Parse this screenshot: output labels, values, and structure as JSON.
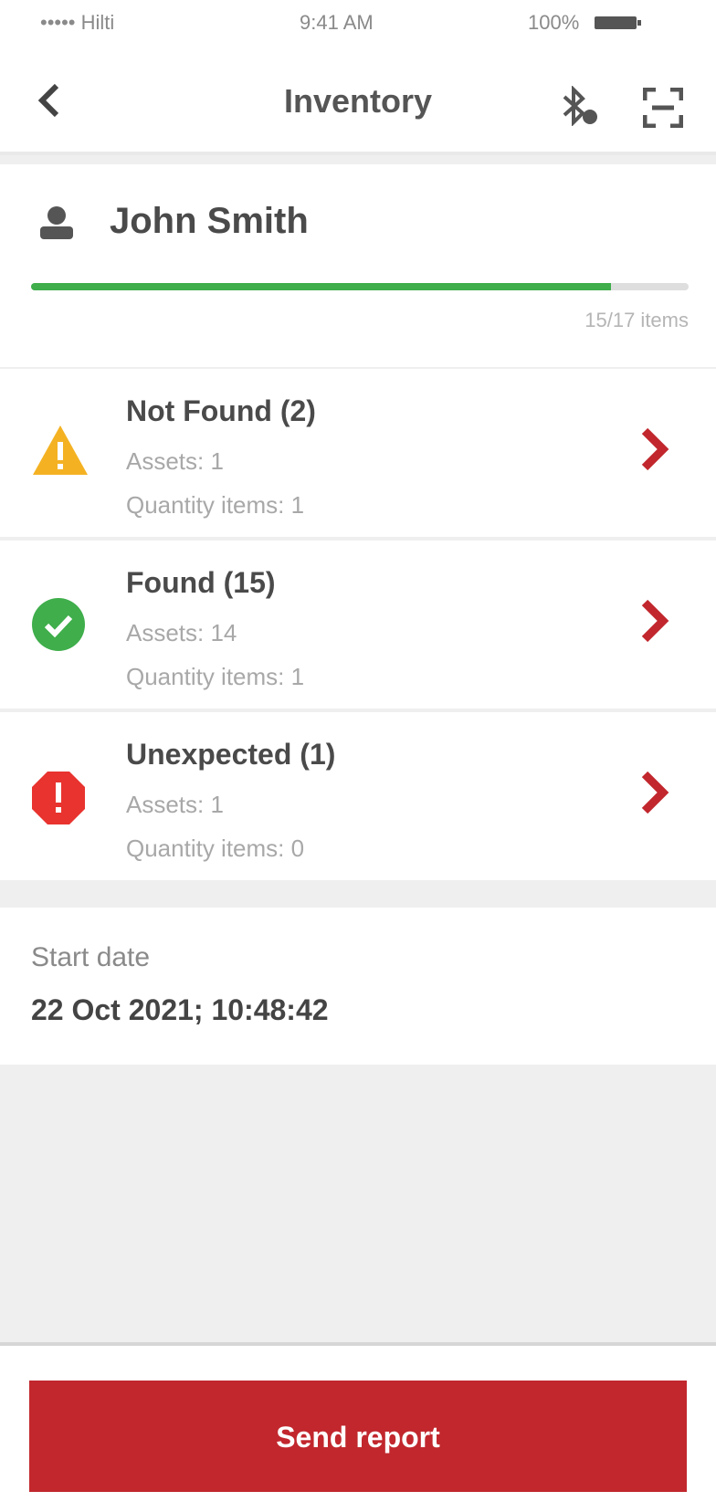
{
  "status_bar": {
    "carrier": "••••• Hilti",
    "time": "9:41 AM",
    "battery": "100%"
  },
  "nav": {
    "title": "Inventory",
    "back_icon": "chevron-left-icon",
    "bluetooth_icon": "bluetooth-icon",
    "scan_icon": "scan-icon"
  },
  "user": {
    "name": "John Smith",
    "progress_text": "15/17 items",
    "progress_fraction": 0.8824
  },
  "rows": [
    {
      "title": "Not Found (2)",
      "assets": "Assets: 1",
      "quantity": "Quantity items: 1",
      "icon": "warning-icon",
      "color": "#f4b223"
    },
    {
      "title": "Found (15)",
      "assets": "Assets: 14",
      "quantity": "Quantity items: 1",
      "icon": "check-circle-icon",
      "color": "#3fae4b"
    },
    {
      "title": "Unexpected (1)",
      "assets": "Assets: 1",
      "quantity": "Quantity items: 0",
      "icon": "error-octagon-icon",
      "color": "#e8332e"
    }
  ],
  "start": {
    "label": "Start date",
    "value": "22 Oct 2021; 10:48:42"
  },
  "footer": {
    "send_label": "Send report"
  },
  "colors": {
    "accent": "#c1272d",
    "progress": "#3fae4b"
  }
}
